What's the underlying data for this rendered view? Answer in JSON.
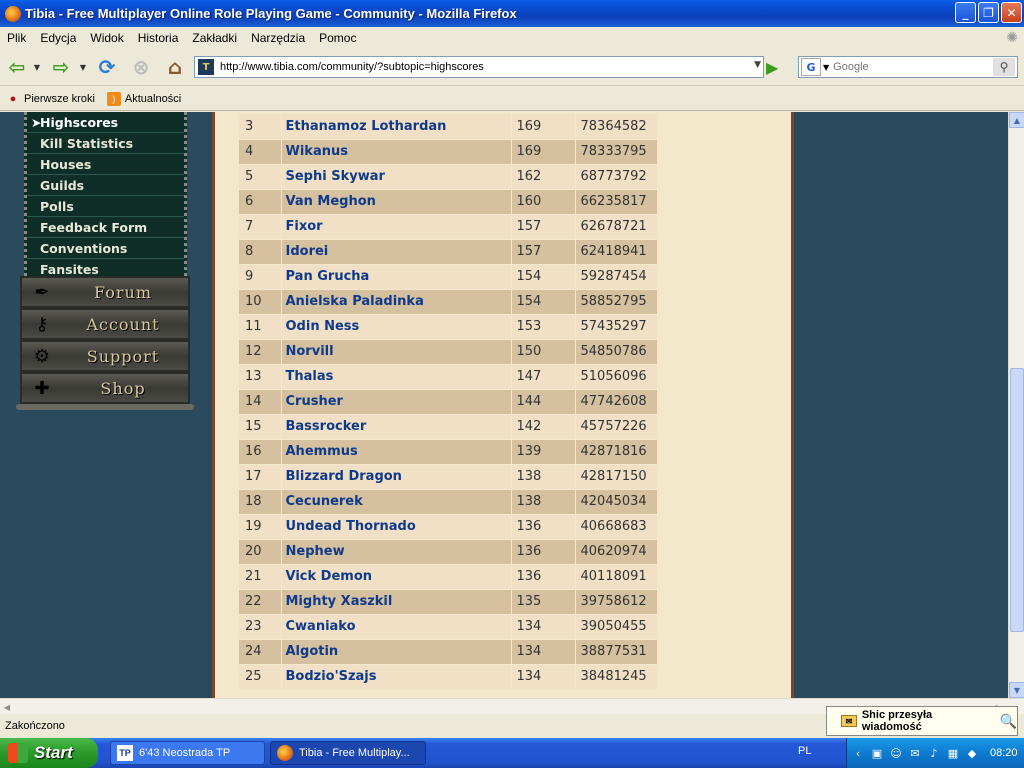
{
  "window": {
    "title": "Tibia - Free Multiplayer Online Role Playing Game - Community - Mozilla Firefox",
    "minimize": "_",
    "maximize": "❐",
    "close": "✕"
  },
  "menu": [
    "Plik",
    "Edycja",
    "Widok",
    "Historia",
    "Zakładki",
    "Narzędzia",
    "Pomoc"
  ],
  "address": {
    "url": "http://www.tibia.com/community/?subtopic=highscores",
    "favicon": "T"
  },
  "search": {
    "engine": "G",
    "placeholder": "Google"
  },
  "bookmarks": [
    "Pierwsze kroki",
    "Aktualności"
  ],
  "sidebar": {
    "items": [
      "Highscores",
      "Kill Statistics",
      "Houses",
      "Guilds",
      "Polls",
      "Feedback Form",
      "Conventions",
      "Fansites"
    ],
    "active": "Highscores",
    "buttons": [
      "Forum",
      "Account",
      "Support",
      "Shop"
    ]
  },
  "highscores": [
    {
      "rank": "3",
      "name": "Ethanamoz Lothardan",
      "level": "169",
      "points": "78364582"
    },
    {
      "rank": "4",
      "name": "Wikanus",
      "level": "169",
      "points": "78333795"
    },
    {
      "rank": "5",
      "name": "Sephi Skywar",
      "level": "162",
      "points": "68773792"
    },
    {
      "rank": "6",
      "name": "Van Meghon",
      "level": "160",
      "points": "66235817"
    },
    {
      "rank": "7",
      "name": "Fixor",
      "level": "157",
      "points": "62678721"
    },
    {
      "rank": "8",
      "name": "Idorei",
      "level": "157",
      "points": "62418941"
    },
    {
      "rank": "9",
      "name": "Pan Grucha",
      "level": "154",
      "points": "59287454"
    },
    {
      "rank": "10",
      "name": "Anielska Paladinka",
      "level": "154",
      "points": "58852795"
    },
    {
      "rank": "11",
      "name": "Odin Ness",
      "level": "153",
      "points": "57435297"
    },
    {
      "rank": "12",
      "name": "Norvill",
      "level": "150",
      "points": "54850786"
    },
    {
      "rank": "13",
      "name": "Thalas",
      "level": "147",
      "points": "51056096"
    },
    {
      "rank": "14",
      "name": "Crusher",
      "level": "144",
      "points": "47742608"
    },
    {
      "rank": "15",
      "name": "Bassrocker",
      "level": "142",
      "points": "45757226"
    },
    {
      "rank": "16",
      "name": "Ahemmus",
      "level": "139",
      "points": "42871816"
    },
    {
      "rank": "17",
      "name": "Blizzard Dragon",
      "level": "138",
      "points": "42817150"
    },
    {
      "rank": "18",
      "name": "Cecunerek",
      "level": "138",
      "points": "42045034"
    },
    {
      "rank": "19",
      "name": "Undead Thornado",
      "level": "136",
      "points": "40668683"
    },
    {
      "rank": "20",
      "name": "Nephew",
      "level": "136",
      "points": "40620974"
    },
    {
      "rank": "21",
      "name": "Vick Demon",
      "level": "136",
      "points": "40118091"
    },
    {
      "rank": "22",
      "name": "Mighty Xaszkil",
      "level": "135",
      "points": "39758612"
    },
    {
      "rank": "23",
      "name": "Cwaniako",
      "level": "134",
      "points": "39050455"
    },
    {
      "rank": "24",
      "name": "Algotin",
      "level": "134",
      "points": "38877531"
    },
    {
      "rank": "25",
      "name": "Bodzio'Szajs",
      "level": "134",
      "points": "38481245"
    }
  ],
  "status": {
    "text": "Zakończono"
  },
  "notification": {
    "text": "Shic przesyła wiadomość"
  },
  "taskbar": {
    "start": "Start",
    "tasks": [
      "6'43 Neostrada TP",
      "Tibia - Free Multiplay..."
    ],
    "language": "PL",
    "clock": "08:20"
  },
  "colors": {
    "link": "#0f3a8a",
    "row_light": "#f1e0c6",
    "row_dark": "#d5c09f",
    "page_bg": "#2c4a5e",
    "sidebar_bg": "#0f2e28"
  },
  "icons": {
    "back": "back-arrow-icon",
    "forward": "forward-arrow-icon",
    "reload": "reload-icon",
    "stop": "stop-icon",
    "home": "home-icon",
    "go": "go-arrow-icon",
    "search": "magnifier-icon"
  }
}
